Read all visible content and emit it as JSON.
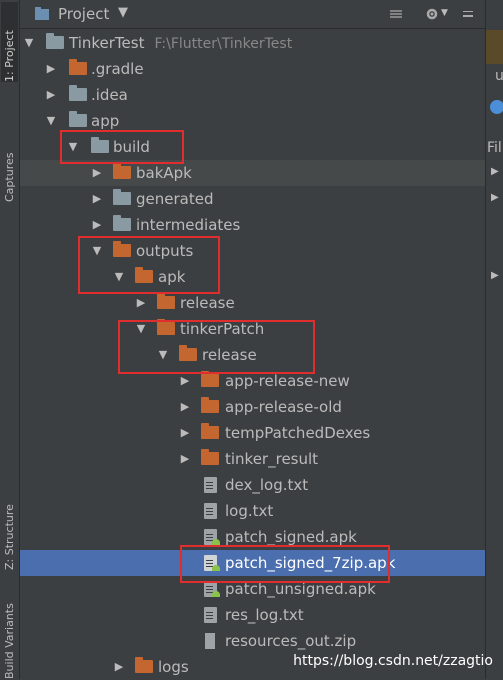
{
  "sidebar": {
    "tabs": [
      {
        "label": "1: Project"
      },
      {
        "label": "Captures"
      },
      {
        "label": "Z: Structure"
      },
      {
        "label": "Build Variants"
      }
    ]
  },
  "header": {
    "title": "Project"
  },
  "tree": {
    "rows": [
      {
        "label": "TinkerTest",
        "path": "F:\\Flutter\\TinkerTest"
      },
      {
        "label": ".gradle"
      },
      {
        "label": ".idea"
      },
      {
        "label": "app"
      },
      {
        "label": "build"
      },
      {
        "label": "bakApk"
      },
      {
        "label": "generated"
      },
      {
        "label": "intermediates"
      },
      {
        "label": "outputs"
      },
      {
        "label": "apk"
      },
      {
        "label": "release"
      },
      {
        "label": "tinkerPatch"
      },
      {
        "label": "release"
      },
      {
        "label": "app-release-new"
      },
      {
        "label": "app-release-old"
      },
      {
        "label": "tempPatchedDexes"
      },
      {
        "label": "tinker_result"
      },
      {
        "label": "dex_log.txt"
      },
      {
        "label": "log.txt"
      },
      {
        "label": "patch_signed.apk"
      },
      {
        "label": "patch_signed_7zip.apk"
      },
      {
        "label": "patch_unsigned.apk"
      },
      {
        "label": "res_log.txt"
      },
      {
        "label": "resources_out.zip"
      },
      {
        "label": "logs"
      }
    ]
  },
  "right_panel": {
    "partial_labels": [
      "u",
      "Fil"
    ]
  },
  "watermark": "https://blog.csdn.net/zzagtio",
  "colors": {
    "selection": "#4b6eaf",
    "highlight_box": "#e02d2d",
    "folder_orange": "#c4662f",
    "folder_gray": "#8a9aa3"
  }
}
